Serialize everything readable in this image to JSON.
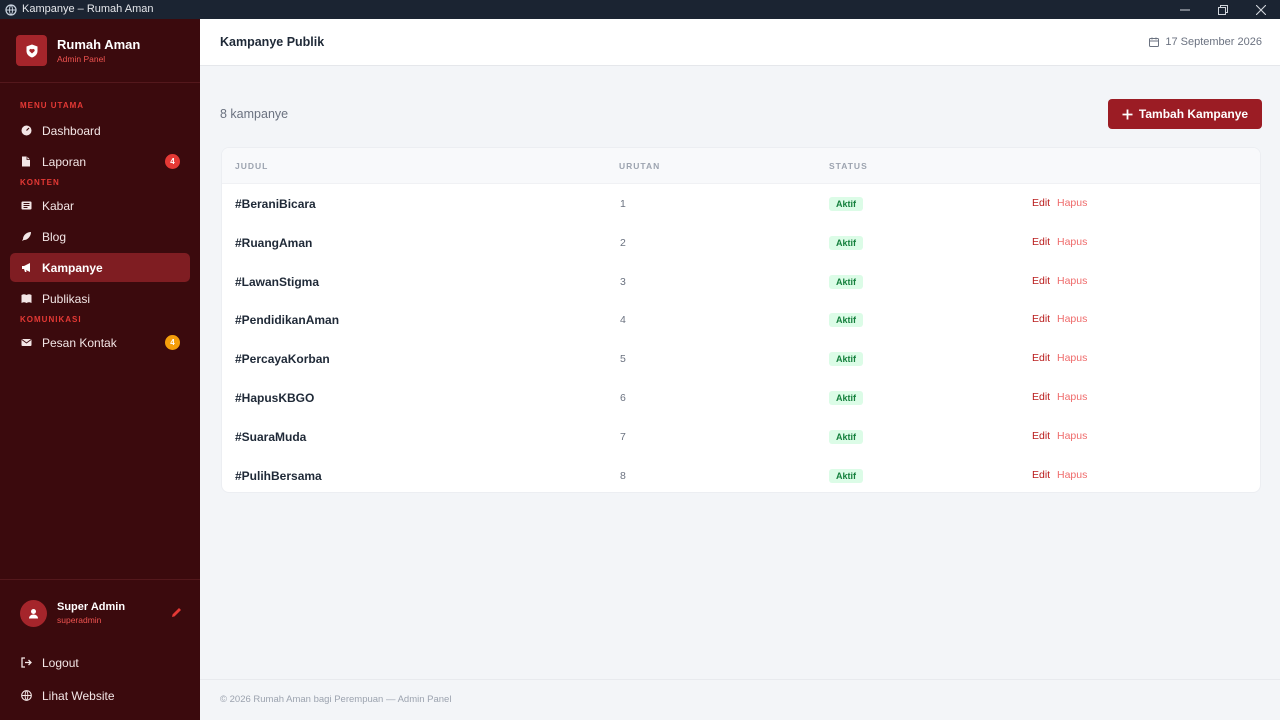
{
  "window": {
    "title": "Kampanye – Rumah Aman"
  },
  "brand": {
    "name": "Rumah Aman",
    "subtitle": "Admin Panel"
  },
  "nav": {
    "section_main": "MENU UTAMA",
    "section_content": "KONTEN",
    "section_comm": "KOMUNIKASI",
    "dashboard": "Dashboard",
    "laporan": "Laporan",
    "laporan_badge": "4",
    "kabar": "Kabar",
    "blog": "Blog",
    "kampanye": "Kampanye",
    "publikasi": "Publikasi",
    "pesan_kontak": "Pesan Kontak",
    "pesan_badge": "4"
  },
  "user": {
    "name": "Super Admin",
    "handle": "superadmin",
    "logout": "Logout",
    "view_site": "Lihat Website"
  },
  "header": {
    "title": "Kampanye Publik",
    "date": "17 September 2026"
  },
  "main": {
    "count_text": "8 kampanye",
    "add_button": "Tambah Kampanye",
    "columns": {
      "title": "JUDUL",
      "order": "URUTAN",
      "status": "STATUS"
    },
    "edit_label": "Edit",
    "delete_label": "Hapus",
    "rows": [
      {
        "title": "#BeraniBicara",
        "order": "1",
        "status": "Aktif"
      },
      {
        "title": "#RuangAman",
        "order": "2",
        "status": "Aktif"
      },
      {
        "title": "#LawanStigma",
        "order": "3",
        "status": "Aktif"
      },
      {
        "title": "#PendidikanAman",
        "order": "4",
        "status": "Aktif"
      },
      {
        "title": "#PercayaKorban",
        "order": "5",
        "status": "Aktif"
      },
      {
        "title": "#HapusKBGO",
        "order": "6",
        "status": "Aktif"
      },
      {
        "title": "#SuaraMuda",
        "order": "7",
        "status": "Aktif"
      },
      {
        "title": "#PulihBersama",
        "order": "8",
        "status": "Aktif"
      }
    ]
  },
  "footer": {
    "text": "© 2026 Rumah Aman bagi Perempuan — Admin Panel"
  },
  "colors": {
    "sidebar_bg": "#3b0a0d",
    "accent": "#9b1c24",
    "active_nav": "#7f1d22",
    "status_bg": "#dcfce7",
    "status_text": "#15803d"
  }
}
